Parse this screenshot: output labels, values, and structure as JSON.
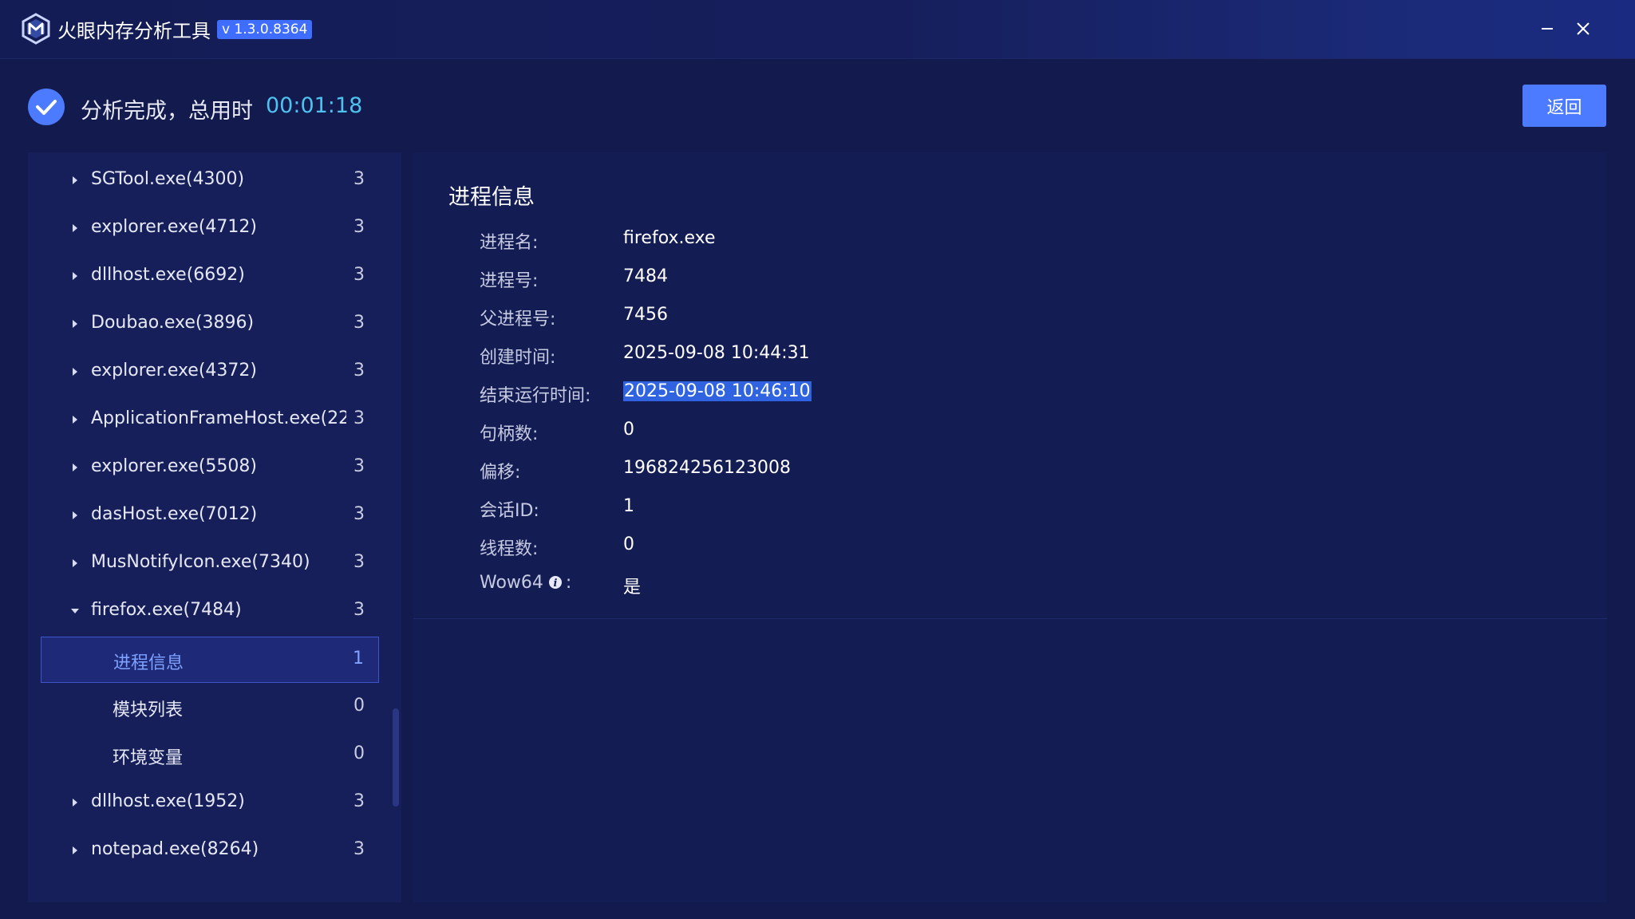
{
  "app": {
    "title": "火眼内存分析工具",
    "version": "v 1.3.0.8364"
  },
  "status": {
    "message": "分析完成，总用时",
    "elapsed": "00:01:18",
    "back_label": "返回"
  },
  "tree": {
    "rows": [
      {
        "label": "SGTool.exe(4300)",
        "count": "3",
        "expanded": false
      },
      {
        "label": "explorer.exe(4712)",
        "count": "3",
        "expanded": false
      },
      {
        "label": "dllhost.exe(6692)",
        "count": "3",
        "expanded": false
      },
      {
        "label": "Doubao.exe(3896)",
        "count": "3",
        "expanded": false
      },
      {
        "label": "explorer.exe(4372)",
        "count": "3",
        "expanded": false
      },
      {
        "label": "ApplicationFrameHost.exe(22...",
        "count": "3",
        "expanded": false
      },
      {
        "label": "explorer.exe(5508)",
        "count": "3",
        "expanded": false
      },
      {
        "label": "dasHost.exe(7012)",
        "count": "3",
        "expanded": false
      },
      {
        "label": "MusNotifyIcon.exe(7340)",
        "count": "3",
        "expanded": false
      },
      {
        "label": "firefox.exe(7484)",
        "count": "3",
        "expanded": true
      },
      {
        "label": "进程信息",
        "count": "1",
        "child": true,
        "selected": true
      },
      {
        "label": "模块列表",
        "count": "0",
        "child": true
      },
      {
        "label": "环境变量",
        "count": "0",
        "child": true
      },
      {
        "label": "dllhost.exe(1952)",
        "count": "3",
        "expanded": false
      },
      {
        "label": "notepad.exe(8264)",
        "count": "3",
        "expanded": false
      }
    ]
  },
  "detail": {
    "title": "进程信息",
    "rows": [
      {
        "key": "进程名:",
        "value": "firefox.exe"
      },
      {
        "key": "进程号:",
        "value": "7484"
      },
      {
        "key": "父进程号:",
        "value": "7456"
      },
      {
        "key": "创建时间:",
        "value": "2025-09-08 10:44:31"
      },
      {
        "key": "结束运行时间:",
        "value": "2025-09-08 10:46:10"
      },
      {
        "key": "句柄数:",
        "value": "0"
      },
      {
        "key": "偏移:",
        "value": "196824256123008"
      },
      {
        "key": "会话ID:",
        "value": "1"
      },
      {
        "key": "线程数:",
        "value": "0"
      },
      {
        "key": "Wow64",
        "key_suffix": ":",
        "value": "是"
      }
    ]
  },
  "colors": {
    "background": "#121a4e",
    "accent": "#4d7bff",
    "time": "#4fc3f0",
    "selection": "#7fa2ff"
  }
}
